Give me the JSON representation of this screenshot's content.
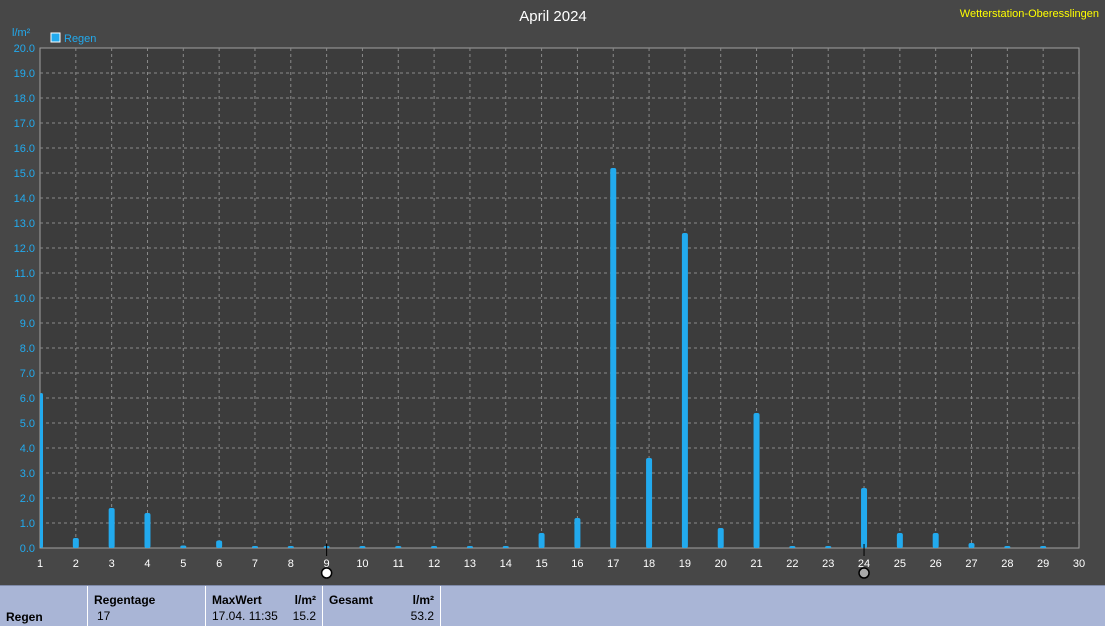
{
  "chart_data": {
    "type": "bar",
    "title": "April 2024",
    "station": "Wetterstation-Oberesslingen",
    "ylabel": "l/m²",
    "legend": [
      {
        "name": "Regen",
        "color": "#22aaee"
      }
    ],
    "x": [
      1,
      2,
      3,
      4,
      5,
      6,
      7,
      8,
      9,
      10,
      11,
      12,
      13,
      14,
      15,
      16,
      17,
      18,
      19,
      20,
      21,
      22,
      23,
      24,
      25,
      26,
      27,
      28,
      29,
      30
    ],
    "series": [
      {
        "name": "Regen",
        "color": "#22aaee",
        "x": [
          1,
          2,
          3,
          4,
          5,
          6,
          7,
          8,
          9,
          10,
          11,
          12,
          13,
          14,
          15,
          16,
          17,
          18,
          19,
          20,
          21,
          22,
          23,
          24,
          25,
          26,
          27,
          28,
          29
        ],
        "values": [
          6.2,
          0.4,
          1.6,
          1.4,
          0.1,
          0.3,
          0,
          0,
          0,
          0,
          0,
          0,
          0,
          0,
          0.6,
          1.2,
          15.2,
          3.6,
          12.6,
          0.8,
          5.4,
          0,
          0,
          2.4,
          0.6,
          0.6,
          0.2,
          0,
          0
        ]
      }
    ],
    "ylim": [
      0,
      20
    ],
    "xlim": [
      1,
      30
    ],
    "yticks": [
      "0.0",
      "1.0",
      "2.0",
      "3.0",
      "4.0",
      "5.0",
      "6.0",
      "7.0",
      "8.0",
      "9.0",
      "10.0",
      "11.0",
      "12.0",
      "13.0",
      "14.0",
      "15.0",
      "16.0",
      "17.0",
      "18.0",
      "19.0",
      "20.0"
    ],
    "grid": true,
    "markers": [
      {
        "x": 9,
        "symbol": "full-moon"
      },
      {
        "x": 24,
        "symbol": "new-moon"
      }
    ]
  },
  "summary": {
    "row_label": "Regen",
    "regentage_label": "Regentage",
    "regentage_value": "17",
    "maxwert_label": "MaxWert",
    "maxwert_unit": "l/m²",
    "maxwert_time": "17.04.  11:35",
    "maxwert_value": "15.2",
    "gesamt_label": "Gesamt",
    "gesamt_unit": "l/m²",
    "gesamt_value": "53.2"
  }
}
